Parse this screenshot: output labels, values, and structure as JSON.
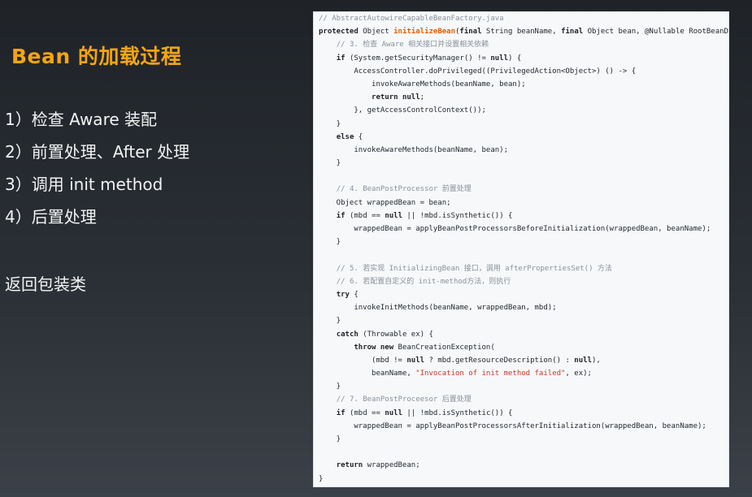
{
  "slide": {
    "title": "Bean 的加载过程",
    "steps": [
      "1）检查 Aware 装配",
      "2）前置处理、After 处理",
      "3）调用 init method",
      "4）后置处理"
    ],
    "note": "返回包装类"
  },
  "code": {
    "lines": [
      [
        {
          "k": "c",
          "v": "// AbstractAutowireCapableBeanFactory.java"
        }
      ],
      [
        {
          "k": "k",
          "v": "protected"
        },
        {
          "k": "p",
          "v": " Object "
        },
        {
          "k": "t",
          "v": "initializeBean"
        },
        {
          "k": "p",
          "v": "("
        },
        {
          "k": "k",
          "v": "final"
        },
        {
          "k": "p",
          "v": " String beanName, "
        },
        {
          "k": "k",
          "v": "final"
        },
        {
          "k": "p",
          "v": " Object bean, @Nullable RootBeanDefin"
        }
      ],
      [
        {
          "k": "p",
          "v": "    "
        },
        {
          "k": "c",
          "v": "// 3. 检查 Aware 相关接口并设置相关依赖"
        }
      ],
      [
        {
          "k": "p",
          "v": "    "
        },
        {
          "k": "k",
          "v": "if"
        },
        {
          "k": "p",
          "v": " (System.getSecurityManager() != "
        },
        {
          "k": "k",
          "v": "null"
        },
        {
          "k": "p",
          "v": ") {"
        }
      ],
      [
        {
          "k": "p",
          "v": "        AccessController.doPrivileged((PrivilegedAction<Object>) () -> {"
        }
      ],
      [
        {
          "k": "p",
          "v": "            invokeAwareMethods(beanName, bean);"
        }
      ],
      [
        {
          "k": "p",
          "v": "            "
        },
        {
          "k": "k",
          "v": "return null"
        },
        {
          "k": "p",
          "v": ";"
        }
      ],
      [
        {
          "k": "p",
          "v": "        }, getAccessControlContext());"
        }
      ],
      [
        {
          "k": "p",
          "v": "    }"
        }
      ],
      [
        {
          "k": "p",
          "v": "    "
        },
        {
          "k": "k",
          "v": "else"
        },
        {
          "k": "p",
          "v": " {"
        }
      ],
      [
        {
          "k": "p",
          "v": "        invokeAwareMethods(beanName, bean);"
        }
      ],
      [
        {
          "k": "p",
          "v": "    }"
        }
      ],
      [
        {
          "k": "p",
          "v": ""
        }
      ],
      [
        {
          "k": "p",
          "v": "    "
        },
        {
          "k": "c",
          "v": "// 4. BeanPostProcessor 前置处理"
        }
      ],
      [
        {
          "k": "p",
          "v": "    Object wrappedBean = bean;"
        }
      ],
      [
        {
          "k": "p",
          "v": "    "
        },
        {
          "k": "k",
          "v": "if"
        },
        {
          "k": "p",
          "v": " (mbd == "
        },
        {
          "k": "k",
          "v": "null"
        },
        {
          "k": "p",
          "v": " || !mbd.isSynthetic()) {"
        }
      ],
      [
        {
          "k": "p",
          "v": "        wrappedBean = applyBeanPostProcessorsBeforeInitialization(wrappedBean, beanName);"
        }
      ],
      [
        {
          "k": "p",
          "v": "    }"
        }
      ],
      [
        {
          "k": "p",
          "v": ""
        }
      ],
      [
        {
          "k": "p",
          "v": "    "
        },
        {
          "k": "c",
          "v": "// 5. 若实现 InitializingBean 接口，调用 afterPropertiesSet() 方法"
        }
      ],
      [
        {
          "k": "p",
          "v": "    "
        },
        {
          "k": "c",
          "v": "// 6. 若配置自定义的 init-method方法，则执行"
        }
      ],
      [
        {
          "k": "p",
          "v": "    "
        },
        {
          "k": "k",
          "v": "try"
        },
        {
          "k": "p",
          "v": " {"
        }
      ],
      [
        {
          "k": "p",
          "v": "        invokeInitMethods(beanName, wrappedBean, mbd);"
        }
      ],
      [
        {
          "k": "p",
          "v": "    }"
        }
      ],
      [
        {
          "k": "p",
          "v": "    "
        },
        {
          "k": "k",
          "v": "catch"
        },
        {
          "k": "p",
          "v": " (Throwable ex) {"
        }
      ],
      [
        {
          "k": "p",
          "v": "        "
        },
        {
          "k": "k",
          "v": "throw new"
        },
        {
          "k": "p",
          "v": " BeanCreationException("
        }
      ],
      [
        {
          "k": "p",
          "v": "            (mbd != "
        },
        {
          "k": "k",
          "v": "null"
        },
        {
          "k": "p",
          "v": " ? mbd.getResourceDescription() : "
        },
        {
          "k": "k",
          "v": "null"
        },
        {
          "k": "p",
          "v": "),"
        }
      ],
      [
        {
          "k": "p",
          "v": "            beanName, "
        },
        {
          "k": "s",
          "v": "\"Invocation of init method failed\""
        },
        {
          "k": "p",
          "v": ", ex);"
        }
      ],
      [
        {
          "k": "p",
          "v": "    }"
        }
      ],
      [
        {
          "k": "p",
          "v": "    "
        },
        {
          "k": "c",
          "v": "// 7. BeanPostProceesor 后置处理"
        }
      ],
      [
        {
          "k": "p",
          "v": "    "
        },
        {
          "k": "k",
          "v": "if"
        },
        {
          "k": "p",
          "v": " (mbd == "
        },
        {
          "k": "k",
          "v": "null"
        },
        {
          "k": "p",
          "v": " || !mbd.isSynthetic()) {"
        }
      ],
      [
        {
          "k": "p",
          "v": "        wrappedBean = applyBeanPostProcessorsAfterInitialization(wrappedBean, beanName);"
        }
      ],
      [
        {
          "k": "p",
          "v": "    }"
        }
      ],
      [
        {
          "k": "p",
          "v": ""
        }
      ],
      [
        {
          "k": "p",
          "v": "    "
        },
        {
          "k": "k",
          "v": "return"
        },
        {
          "k": "p",
          "v": " wrappedBean;"
        }
      ],
      [
        {
          "k": "p",
          "v": "}"
        }
      ]
    ]
  },
  "colors": {
    "title": "#f5a514",
    "text": "#f3f3f3",
    "code_bg": "#f6f8fa",
    "comment": "#8a9199",
    "string": "#c0392b"
  }
}
